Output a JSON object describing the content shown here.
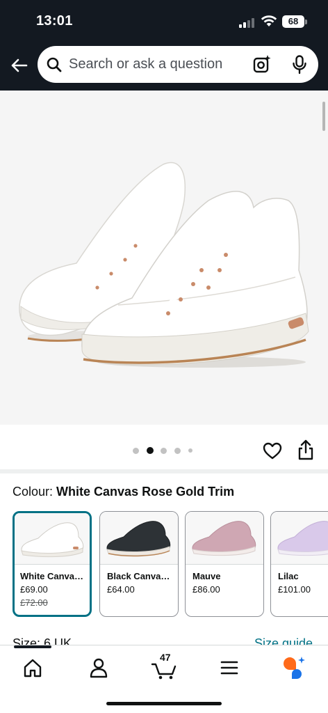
{
  "status_bar": {
    "time": "13:01",
    "battery": "68"
  },
  "header": {
    "search_placeholder": "Search or ask a question",
    "icons": [
      "back-arrow-icon",
      "search-icon",
      "camera-lens-icon",
      "microphone-icon"
    ]
  },
  "gallery": {
    "image_count": 5,
    "active_index": 1,
    "actions": [
      "heart-icon",
      "share-icon"
    ]
  },
  "colour": {
    "label": "Colour:",
    "selected": "White Canvas Rose Gold Trim",
    "options": [
      {
        "name": "White Canvas Rose Gold Trim",
        "price": "£69.00",
        "old_price": "£72.00",
        "color": "#ffffff",
        "sole": "#f2efe8",
        "selected": true
      },
      {
        "name": "Black Canvas Rose Gold Trim",
        "price": "£64.00",
        "old_price": "",
        "color": "#2d3236",
        "sole": "#efe9e2",
        "selected": false
      },
      {
        "name": "Mauve",
        "price": "£86.00",
        "old_price": "",
        "color": "#cfa7b3",
        "sole": "#f3ecea",
        "selected": false
      },
      {
        "name": "Lilac",
        "price": "£101.00",
        "old_price": "",
        "color": "#d9c9ea",
        "sole": "#f1edf5",
        "selected": false
      }
    ]
  },
  "size": {
    "label": "Size: 6 UK",
    "guide_link": "Size guide"
  },
  "bottom_nav": {
    "cart_count": "47",
    "items": [
      "home-icon",
      "account-icon",
      "cart-icon",
      "menu-icon",
      "rufus-assistant-icon"
    ]
  },
  "colors": {
    "header_bg": "#131921",
    "accent_teal": "#007185",
    "image_bg": "#f5f5f5"
  }
}
